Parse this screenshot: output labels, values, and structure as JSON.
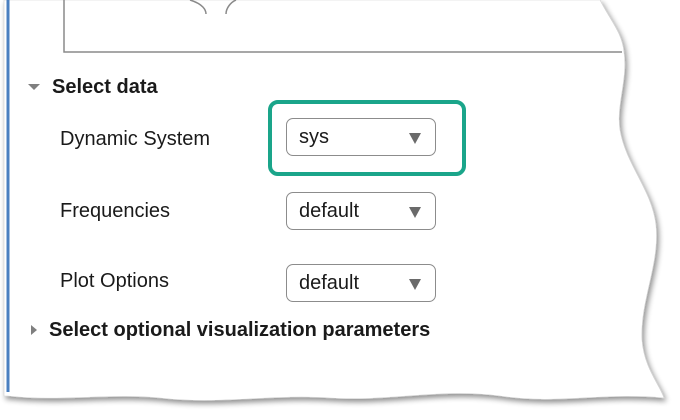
{
  "panel": {
    "sections": {
      "select_data": {
        "label": "Select data",
        "expanded": true
      },
      "optional_visualization": {
        "label": "Select optional visualization parameters",
        "expanded": false
      }
    },
    "fields": {
      "dynamic_system": {
        "label": "Dynamic System",
        "value": "sys"
      },
      "frequencies": {
        "label": "Frequencies",
        "value": "default"
      },
      "plot_options": {
        "label": "Plot Options",
        "value": "default"
      }
    }
  },
  "colors": {
    "highlight": "#1aa58a",
    "panel_edge": "#4a7fc0",
    "background": "#ffffff"
  },
  "icons": {
    "expanded": "triangle-down",
    "collapsed": "triangle-right",
    "dropdown": "triangle-down"
  }
}
